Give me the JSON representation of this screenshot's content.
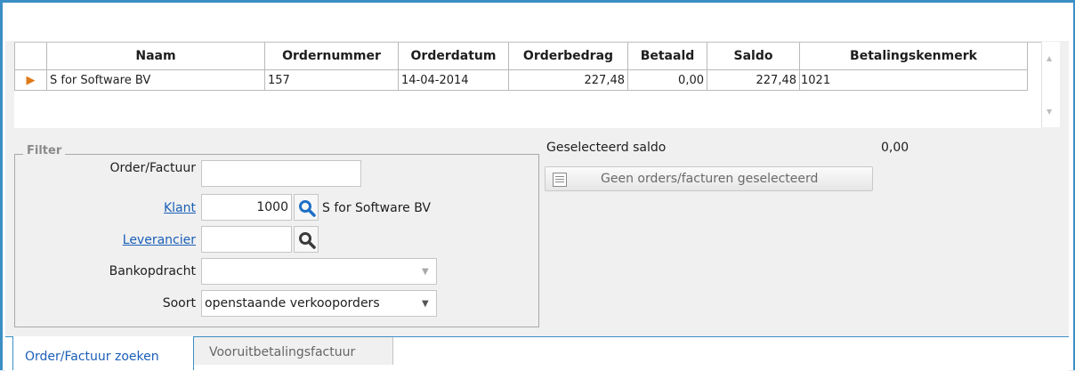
{
  "grid": {
    "columns": [
      "Naam",
      "Ordernummer",
      "Orderdatum",
      "Orderbedrag",
      "Betaald",
      "Saldo",
      "Betalingskenmerk"
    ],
    "rows": [
      {
        "naam": "S for Software BV",
        "ordernummer": "157",
        "orderdatum": "14-04-2014",
        "orderbedrag": "227,48",
        "betaald": "0,00",
        "saldo": "227,48",
        "betalingskenmerk": "1021"
      }
    ]
  },
  "filter": {
    "legend": "Filter",
    "order_factuur_label": "Order/Factuur",
    "order_factuur_value": "",
    "klant_label": "Klant",
    "klant_value": "1000",
    "klant_name": "S for Software BV",
    "leverancier_label": "Leverancier",
    "leverancier_value": "",
    "bankopdracht_label": "Bankopdracht",
    "bankopdracht_value": "",
    "soort_label": "Soort",
    "soort_value": "openstaande verkooporders"
  },
  "selection": {
    "saldo_label": "Geselecteerd saldo",
    "saldo_value": "0,00",
    "button_label": "Geen orders/facturen geselecteerd"
  },
  "tabs": [
    {
      "label": "Order/Factuur zoeken",
      "active": true
    },
    {
      "label": "Vooruitbetalingsfactuur",
      "active": false
    }
  ],
  "colors": {
    "accent": "#3b8fc4",
    "link": "#1a5fb8",
    "search_icon": "#1f6fc5"
  }
}
